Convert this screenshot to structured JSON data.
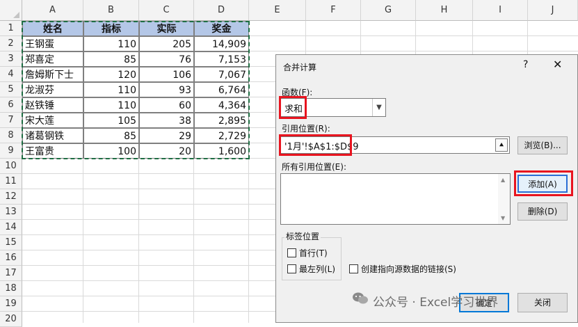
{
  "spreadsheet": {
    "column_headers": [
      "A",
      "B",
      "C",
      "D",
      "E",
      "F",
      "G",
      "H",
      "I",
      "J"
    ],
    "row_headers": [
      "1",
      "2",
      "3",
      "4",
      "5",
      "6",
      "7",
      "8",
      "9",
      "10",
      "11",
      "12",
      "13",
      "14",
      "15",
      "16",
      "17",
      "18",
      "19",
      "20"
    ],
    "table": {
      "headers": [
        "姓名",
        "指标",
        "实际",
        "奖金"
      ],
      "rows": [
        [
          "王钢蛋",
          "110",
          "205",
          "14,909"
        ],
        [
          "郑喜定",
          "85",
          "76",
          "7,153"
        ],
        [
          "詹姆斯下士",
          "120",
          "106",
          "7,067"
        ],
        [
          "龙淑芬",
          "110",
          "93",
          "6,764"
        ],
        [
          "赵铁锤",
          "110",
          "60",
          "4,364"
        ],
        [
          "宋大莲",
          "105",
          "38",
          "2,895"
        ],
        [
          "诸葛钢铁",
          "85",
          "29",
          "2,729"
        ],
        [
          "王富贵",
          "100",
          "20",
          "1,600"
        ]
      ]
    }
  },
  "dialog": {
    "title": "合并计算",
    "help": "?",
    "close": "✕",
    "function_label": "函数(F):",
    "function_value": "求和",
    "reference_label": "引用位置(R):",
    "reference_value": "'1月'!$A$1:$D$9",
    "browse_button": "浏览(B)...",
    "all_references_label": "所有引用位置(E):",
    "add_button": "添加(A)",
    "delete_button": "删除(D)",
    "labels_group": "标签位置",
    "top_row": "首行(T)",
    "left_column": "最左列(L)",
    "create_links": "创建指向源数据的链接(S)",
    "ok_button": "确定",
    "close_button": "关闭"
  },
  "watermark": {
    "text": "公众号 · Excel学习世界"
  },
  "colors": {
    "header_fill": "#b4c7e7",
    "highlight": "#e8141f",
    "marquee": "#1f6e43"
  }
}
